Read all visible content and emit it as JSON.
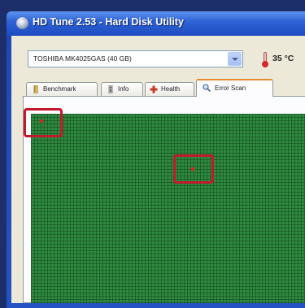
{
  "window": {
    "title": "HD Tune 2.53 - Hard Disk Utility"
  },
  "drive_select": {
    "value": "TOSHIBA MK4025GAS (40 GB)"
  },
  "temperature": {
    "value": "35 °C"
  },
  "tabs": [
    {
      "label": "Benchmark",
      "icon": "ruler-icon",
      "active": false
    },
    {
      "label": "Info",
      "icon": "info-icon",
      "active": false
    },
    {
      "label": "Health",
      "icon": "health-cross-icon",
      "active": false
    },
    {
      "label": "Error Scan",
      "icon": "magnifier-icon",
      "active": true
    }
  ],
  "error_scan": {
    "block_color_ok": "#2f8a3f",
    "block_color_damaged": "#e02020",
    "damaged_blocks_marked": 2,
    "highlight_color": "#c4182d"
  },
  "colors": {
    "title_bar": "#2f63d6",
    "window_background": "#ece9d8",
    "active_tab_accent": "#e68b2c"
  }
}
